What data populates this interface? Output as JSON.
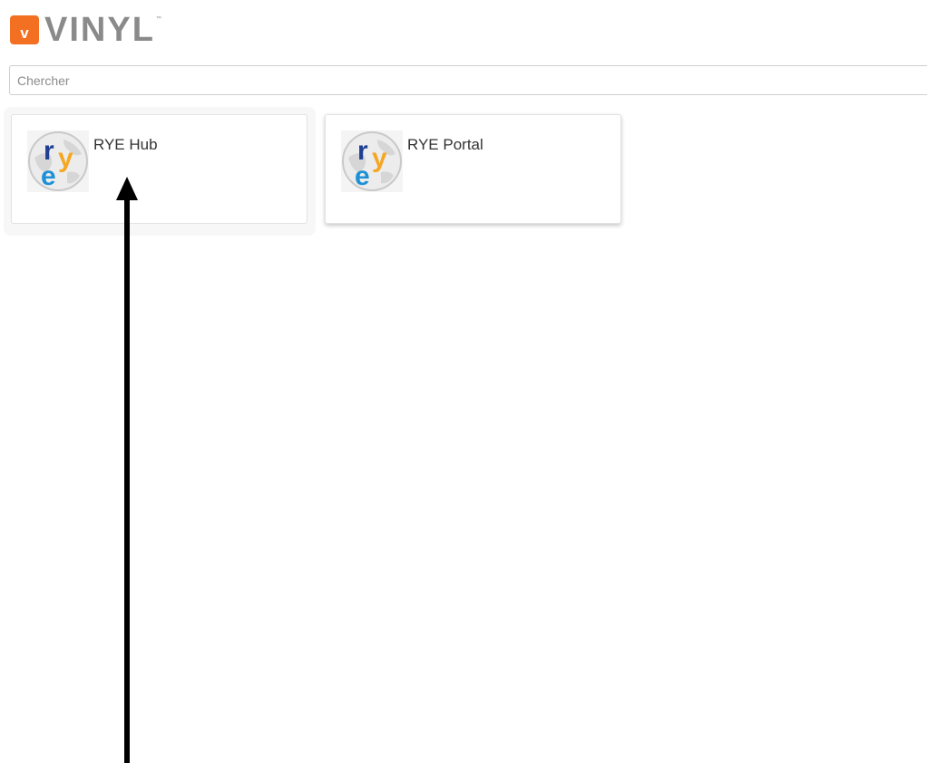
{
  "brand": {
    "badge_letter": "v",
    "wordmark": "VINYL",
    "trademark": "™",
    "badge_color": "#f36f21",
    "wordmark_color": "#8a8a8a"
  },
  "search": {
    "placeholder": "Chercher",
    "value": ""
  },
  "apps": [
    {
      "title": "RYE Hub",
      "icon": "rye-globe-logo"
    },
    {
      "title": "RYE Portal",
      "icon": "rye-globe-logo"
    }
  ],
  "annotation": {
    "icon": "black-arrow-up",
    "color": "#000000"
  }
}
